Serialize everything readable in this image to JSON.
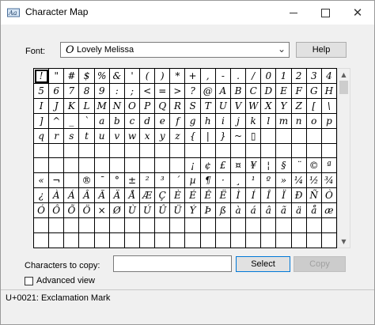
{
  "window": {
    "title": "Character Map",
    "app_icon": "character-map-app-icon"
  },
  "controls": {
    "minimize": "minimize-icon",
    "maximize": "maximize-icon",
    "close": "close-icon"
  },
  "font": {
    "label": "Font:",
    "selected": "Lovely Melissa",
    "icon": "O",
    "chevron": "⌄"
  },
  "help_button": "Help",
  "characters": [
    [
      "!",
      "\"",
      "#",
      "$",
      "%",
      "&",
      "'",
      "(",
      ")",
      "*",
      "+",
      ",",
      "-",
      ".",
      "/",
      "0",
      "1",
      "2",
      "3",
      "4"
    ],
    [
      "5",
      "6",
      "7",
      "8",
      "9",
      ":",
      ";",
      "<",
      "=",
      ">",
      "?",
      "@",
      "A",
      "B",
      "C",
      "D",
      "E",
      "F",
      "G",
      "H"
    ],
    [
      "I",
      "J",
      "K",
      "L",
      "M",
      "N",
      "O",
      "P",
      "Q",
      "R",
      "S",
      "T",
      "U",
      "V",
      "W",
      "X",
      "Y",
      "Z",
      "[",
      "\\"
    ],
    [
      "]",
      "^",
      "_",
      "`",
      "a",
      "b",
      "c",
      "d",
      "e",
      "f",
      "g",
      "h",
      "i",
      "j",
      "k",
      "l",
      "m",
      "n",
      "o",
      "p"
    ],
    [
      "q",
      "r",
      "s",
      "t",
      "u",
      "v",
      "w",
      "x",
      "y",
      "z",
      "{",
      "|",
      "}",
      "~",
      "▯",
      "",
      "",
      "",
      "",
      ""
    ],
    [
      "",
      "",
      "",
      "",
      "",
      "",
      "",
      "",
      "",
      "",
      "",
      "",
      "",
      "",
      "",
      "",
      "",
      "",
      "",
      ""
    ],
    [
      "",
      "",
      "",
      "",
      "",
      "",
      "",
      "",
      "",
      "",
      "¡",
      "¢",
      "£",
      "¤",
      "¥",
      "¦",
      "§",
      "¨",
      "©",
      "ª"
    ],
    [
      "«",
      "¬",
      "",
      "®",
      "¯",
      "°",
      "±",
      "²",
      "³",
      "´",
      "µ",
      "¶",
      "·",
      "¸",
      "¹",
      "º",
      "»",
      "¼",
      "½",
      "¾"
    ],
    [
      "¿",
      "À",
      "Á",
      "Â",
      "Ã",
      "Ä",
      "Å",
      "Æ",
      "Ç",
      "È",
      "É",
      "Ê",
      "Ë",
      "Ì",
      "Í",
      "Î",
      "Ï",
      "Ð",
      "Ñ",
      "Ò"
    ],
    [
      "Ó",
      "Ô",
      "Õ",
      "Ö",
      "×",
      "Ø",
      "Ù",
      "Ú",
      "Û",
      "Ü",
      "Ý",
      "Þ",
      "ß",
      "à",
      "á",
      "â",
      "ã",
      "ä",
      "å",
      "æ"
    ],
    [
      "",
      "",
      "",
      "",
      "",
      "",
      "",
      "",
      "",
      "",
      "",
      "",
      "",
      "",
      "",
      "",
      "",
      "",
      "",
      ""
    ],
    [
      "",
      "",
      "",
      "",
      "",
      "",
      "",
      "",
      "",
      "",
      "",
      "",
      "",
      "",
      "",
      "",
      "",
      "",
      "",
      ""
    ]
  ],
  "scrollbar": {
    "up_icon": "▲",
    "down_icon": "▼"
  },
  "copy": {
    "label": "Characters to copy:",
    "value": "",
    "select_button": "Select",
    "copy_button": "Copy"
  },
  "advanced_view": {
    "label": "Advanced view",
    "checked": false
  },
  "status": "U+0021: Exclamation Mark"
}
